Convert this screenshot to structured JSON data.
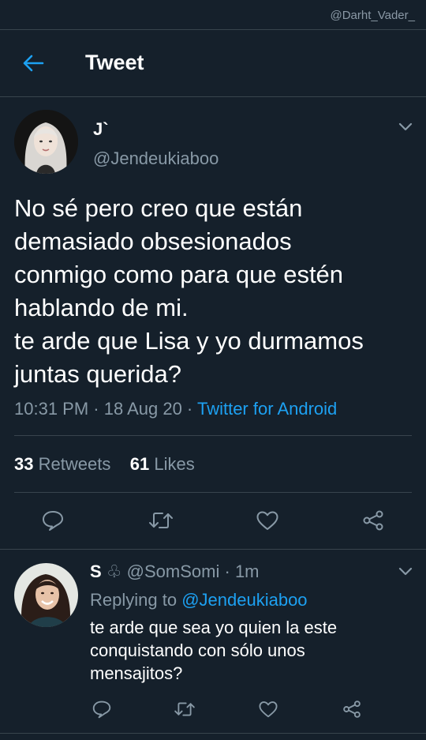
{
  "watermark": "@Darht_Vader_",
  "header": {
    "title": "Tweet"
  },
  "tweet": {
    "author_name": "J`",
    "author_handle": "@Jendeukiaboo",
    "text_lines": [
      "No sé pero creo que están",
      "demasiado obsesionados",
      "conmigo como para que estén",
      "hablando de mi.",
      "te arde que Lisa y yo durmamos",
      "juntas querida?"
    ],
    "meta": "10:31 PM · 18 Aug 20 · ",
    "source": "Twitter for Android",
    "retweets_count": "33",
    "retweets_label": "Retweets",
    "likes_count": "61",
    "likes_label": "Likes"
  },
  "reply": {
    "author_name": "S",
    "author_emoji": "♧",
    "author_handle": "@SomSomi",
    "time": "· 1m",
    "replying_to_label": "Replying to",
    "replying_to_handle": "@Jendeukiaboo",
    "text_lines": [
      "te arde que sea yo quien la este",
      "conquistando con sólo unos",
      "mensajitos?"
    ]
  },
  "colors": {
    "background": "#15202b",
    "accent": "#1da1f2",
    "secondary_text": "#8899a6",
    "divider": "#38444d"
  },
  "icons": [
    "back-arrow-icon",
    "chevron-down-icon",
    "reply-icon",
    "retweet-icon",
    "like-icon",
    "share-icon"
  ]
}
